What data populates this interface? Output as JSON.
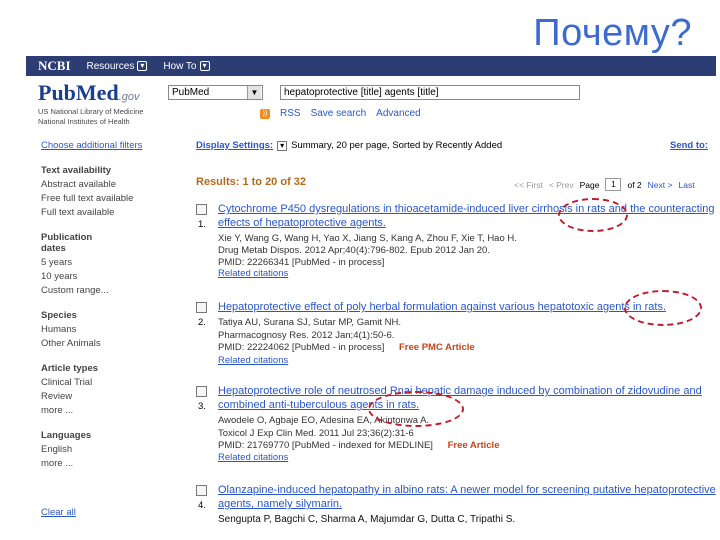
{
  "slide": {
    "title": "Почему?"
  },
  "ncbi_bar": {
    "brand": "NCBI",
    "links": [
      "Resources",
      "How To"
    ]
  },
  "pubmed": {
    "logo": "PubMed",
    "gov": ".gov",
    "org_line1": "US National Library of Medicine",
    "org_line2": "National Institutes of Health",
    "database": "PubMed",
    "query": "hepatoprotective [title] agents [title]",
    "subbar": [
      "RSS",
      "Save search",
      "Advanced"
    ]
  },
  "sidebar": {
    "choose_filters": "Choose additional filters",
    "groups": [
      {
        "heading": "Text availability",
        "items": [
          "Abstract available",
          "Free full text available",
          "Full text available"
        ]
      },
      {
        "heading": "Publication dates",
        "items": [
          "5 years",
          "10 years",
          "Custom range..."
        ]
      },
      {
        "heading": "Species",
        "items": [
          "Humans",
          "Other Animals"
        ]
      },
      {
        "heading": "Article types",
        "items": [
          "Clinical Trial",
          "Review",
          "more ..."
        ]
      },
      {
        "heading": "Languages",
        "items": [
          "English",
          "more ..."
        ]
      }
    ],
    "clear_all": "Clear all"
  },
  "main": {
    "display_settings_label": "Display Settings:",
    "display_settings_value": "Summary, 20 per page, Sorted by Recently Added",
    "send_to": "Send to:",
    "results_title": "Results: 1 to 20 of 32",
    "pager": {
      "first": "<< First",
      "prev": "< Prev",
      "page_label": "Page",
      "page": "1",
      "of": "of 2",
      "next": "Next >",
      "last": "Last"
    }
  },
  "results": [
    {
      "num": "1.",
      "title": "Cytochrome P450 dysregulations in thioacetamide-induced liver cirrhosis in rats and the counteracting effects of hepatoprotective agents.",
      "authors": "Xie Y, Wang G, Wang H, Yao X, Jiang S, Kang A, Zhou F, Xie T, Hao H.",
      "journal": "Drug Metab Dispos. 2012 Apr;40(4):796-802. Epub 2012 Jan 20.",
      "pmid": "PMID: 22266341 [PubMed - in process]",
      "free": "",
      "related": "Related citations"
    },
    {
      "num": "2.",
      "title": "Hepatoprotective effect of poly herbal formulation against various hepatotoxic agents in rats.",
      "authors": "Tatiya AU, Surana SJ, Sutar MP, Gamit NH.",
      "journal": "Pharmacognosy Res. 2012 Jan;4(1):50-6.",
      "pmid": "PMID: 22224062 [PubMed - in process]",
      "free": "Free PMC Article",
      "related": "Related citations"
    },
    {
      "num": "3.",
      "title": "Hepatoprotective role of neutrosed Rnai hepatic damage induced by combination of zidovudine and combined anti-tuberculous agents in rats.",
      "authors": "Awodele O, Agbaje EO, Adesina EA, Akintonwa A.",
      "journal": "Toxicol J Exp Clin Med. 2011 Jul 23;36(2):31-6",
      "pmid": "PMID: 21769770 [PubMed - indexed for MEDLINE]",
      "free": "Free Article",
      "related": "Related citations"
    },
    {
      "num": "4.",
      "title": "Olanzapine-induced hepatopathy in albino rats: A newer model for screening putative hepatoprotective agents, namely silymarin.",
      "authors": "Sengupta P, Bagchi C, Sharma A, Majumdar G, Dutta C, Tripathi S.",
      "journal": "",
      "pmid": "",
      "free": "",
      "related": ""
    }
  ],
  "colors": {
    "link": "#2a56c6",
    "results_title": "#b26a1b",
    "annotation": "#c11b2d",
    "slide_title": "#3c6bd0",
    "ncbi_bar": "#2c3d73"
  }
}
